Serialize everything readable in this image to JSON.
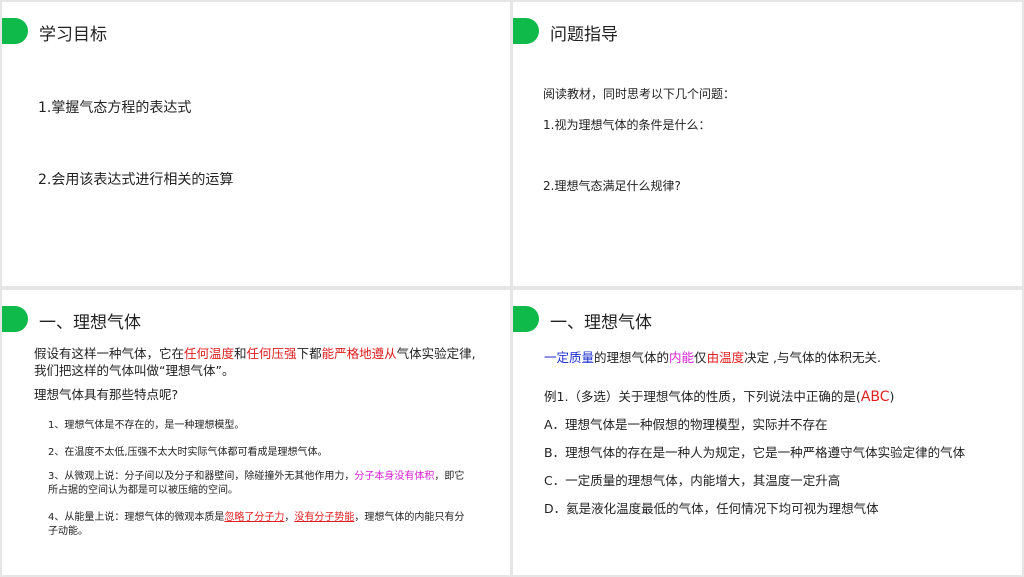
{
  "slide1": {
    "title": "学习目标",
    "items": [
      "1.掌握气态方程的表达式",
      "2.会用该表达式进行相关的运算"
    ]
  },
  "slide2": {
    "title": "问题指导",
    "intro": "阅读教材，同时思考以下几个问题：",
    "q1": "1.视为理想气体的条件是什么：",
    "q2": "2.理想气态满足什么规律?"
  },
  "slide3": {
    "title": "一、理想气体",
    "def": {
      "a": "假设有这样一种气体，它在",
      "b": "任何温度",
      "c": "和",
      "d": "任何压强",
      "e": "下都",
      "f": "能严格地遵从",
      "g": "气体实验定律,",
      "line2": "我们把这样的气体叫做“理想气体”。"
    },
    "question": "理想气体具有那些特点呢?",
    "p1": "1、理想气体是不存在的，是一种理想模型。",
    "p2": "2、在温度不太低,压强不太大时实际气体都可看成是理想气体。",
    "p3": {
      "a": "3、从微观上说：分子间以及分子和器壁间，除碰撞外无其他作用力，",
      "b": "分子本身没有体积",
      "c": "，即它",
      "line2": "所占据的空间认为都是可以被压缩的空间。"
    },
    "p4": {
      "a": "4、从能量上说：理想气体的微观本质是",
      "b": "忽略了分子力",
      "c": "，",
      "d": "没有分子势能",
      "e": "，理想气体的内能只有分",
      "line2": "子动能。"
    }
  },
  "slide4": {
    "title": "一、理想气体",
    "statement": {
      "a": "一定质量",
      "b": "的理想气体的",
      "c": "内能",
      "d": "仅",
      "e": "由温度",
      "f": "决定 ,与气体的体积无关."
    },
    "example": {
      "a": "例1.（多选）关于理想气体的性质，下列说法中正确的是(",
      "answer": "ABC",
      "b": ")"
    },
    "options": [
      "A．理想气体是一种假想的物理模型，实际并不存在",
      "B．理想气体的存在是一种人为规定，它是一种严格遵守气体实验定律的气体",
      "C．一定质量的理想气体，内能增大，其温度一定升高",
      "D．氦是液化温度最低的气体，任何情况下均可视为理想气体"
    ]
  },
  "colors": {
    "accent": "#0fba4a",
    "red": "#e02020",
    "magenta": "#d51fd5",
    "blue": "#1f2fd0"
  }
}
